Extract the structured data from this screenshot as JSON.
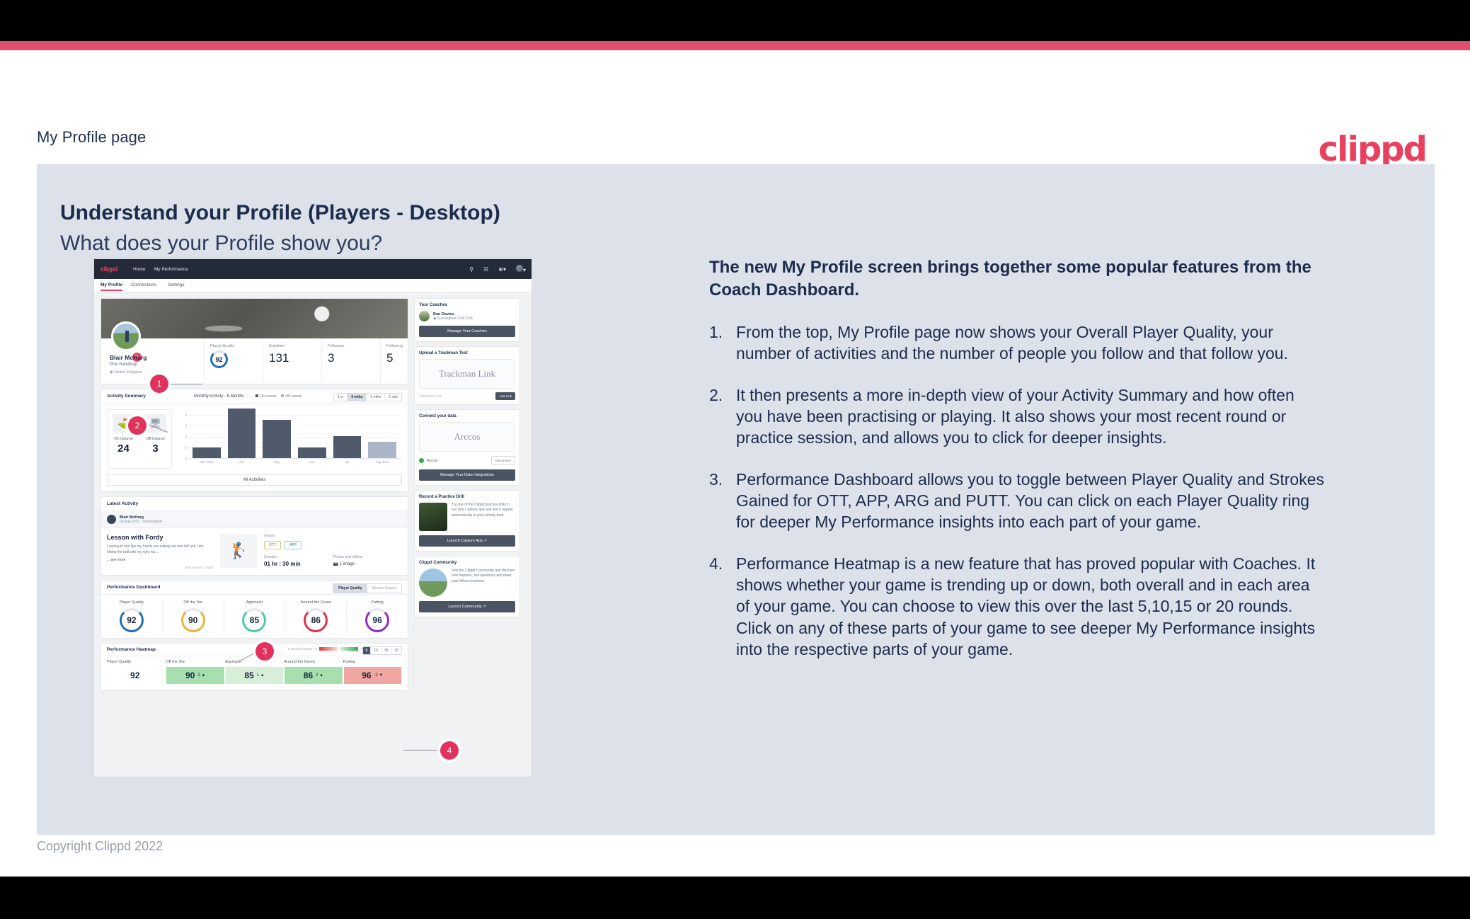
{
  "header": {
    "title": "My Profile page",
    "logo": "clippd"
  },
  "slide": {
    "heading": "Understand your Profile (Players - Desktop)",
    "subheading": "What does your Profile show you?",
    "copyright": "Copyright Clippd 2022"
  },
  "explanation": {
    "lead": "The new My Profile screen brings together some popular features from the Coach Dashboard.",
    "items": [
      {
        "num": "1.",
        "text": "From the top, My Profile page now shows your Overall Player Quality, your number of activities and the number of people you follow and that follow you."
      },
      {
        "num": "2.",
        "text": "It then presents a more in-depth view of your Activity Summary and how often you have been practising or playing. It also shows your most recent round or practice session, and allows you to click for deeper insights."
      },
      {
        "num": "3.",
        "text": "Performance Dashboard allows you to toggle between Player Quality and Strokes Gained for OTT, APP, ARG and PUTT. You can click on each Player Quality ring for deeper My Performance insights into each part of your game."
      },
      {
        "num": "4.",
        "text": "Performance Heatmap is a new feature that has proved popular with Coaches. It shows whether your game is trending up or down, both overall and in each area of your game. You can choose to view this over the last 5,10,15 or 20 rounds. Click on any of these parts of your game to see deeper My Performance insights into the respective parts of your game."
      }
    ]
  },
  "app": {
    "nav": {
      "logo": "clippd",
      "links": [
        "Home",
        "My Performance"
      ],
      "icons": [
        "search-icon",
        "community-icon",
        "add-icon",
        "avatar-icon"
      ]
    },
    "tabs": [
      {
        "label": "My Profile",
        "active": true
      },
      {
        "label": "Connections",
        "active": false
      },
      {
        "label": "Settings",
        "active": false
      }
    ],
    "profile": {
      "name": "Blair McHarg",
      "handicap": "Plus Handicap",
      "location": "United Kingdom",
      "stats": [
        {
          "label": "Player Quality",
          "value": "92",
          "type": "ring"
        },
        {
          "label": "Activities",
          "value": "131"
        },
        {
          "label": "Followers",
          "value": "3"
        },
        {
          "label": "Following",
          "value": "5"
        }
      ]
    },
    "activity": {
      "title": "Activity Summary",
      "chart_title": "Monthly Activity - 6 Months",
      "legend": [
        "On course",
        "Off course"
      ],
      "range_buttons": [
        {
          "label": "1 yr",
          "active": false
        },
        {
          "label": "6 mths",
          "active": true
        },
        {
          "label": "3 mths",
          "active": false
        },
        {
          "label": "1 mth",
          "active": false
        }
      ],
      "counters": [
        {
          "label": "On Course",
          "value": "24",
          "icon": "golf-flag-icon"
        },
        {
          "label": "Off Course",
          "value": "3",
          "icon": "monitor-icon"
        }
      ],
      "all_button": "All Activities"
    },
    "latest": {
      "title": "Latest Activity",
      "user": "Blair McHarg",
      "meta": "03 Aug 2022 - Sunningdale",
      "lesson_title": "Lesson with Fordy",
      "description": "Looking to feel like my hands are exiting low and left and I am hitting the ball with my right hip....",
      "see_more": "... see more",
      "source": "Data Source: Clippd",
      "type_label": "Lesson",
      "chips": [
        "OTT",
        "APP"
      ],
      "duration_label": "Duration",
      "duration": "01 hr : 30 min",
      "photos_label": "Photos and Videos",
      "photos": "1 image"
    },
    "dashboard": {
      "title": "Performance Dashboard",
      "toggle": [
        {
          "label": "Player Quality",
          "active": true
        },
        {
          "label": "Strokes Gained",
          "active": false
        }
      ],
      "rings": [
        {
          "label": "Player Quality",
          "value": "92",
          "color": "#1f6fb2"
        },
        {
          "label": "Off the Tee",
          "value": "90",
          "color": "#eab33a"
        },
        {
          "label": "Approach",
          "value": "85",
          "color": "#4fc9ad"
        },
        {
          "label": "Around the Green",
          "value": "86",
          "color": "#e0314f"
        },
        {
          "label": "Putting",
          "value": "96",
          "color": "#8e2fc4"
        }
      ]
    },
    "heatmap": {
      "title": "Performance Heatmap",
      "scale_label": "5 Round Change",
      "scale_min": "-5",
      "scale_max": "+5",
      "rounds_label": "Rounds",
      "rounds": [
        {
          "label": "5",
          "active": true
        },
        {
          "label": "10",
          "active": false
        },
        {
          "label": "15",
          "active": false
        },
        {
          "label": "20",
          "active": false
        }
      ],
      "cells": [
        {
          "label": "Player Quality",
          "value": "92",
          "delta": "",
          "bg": "#ffffff"
        },
        {
          "label": "Off the Tee",
          "value": "90",
          "delta": "2 ▲",
          "bg": "#a8dfae"
        },
        {
          "label": "Approach",
          "value": "85",
          "delta": "1 ▲",
          "bg": "#d7efd8"
        },
        {
          "label": "Around the Green",
          "value": "86",
          "delta": "2 ▲",
          "bg": "#a8dfae"
        },
        {
          "label": "Putting",
          "value": "96",
          "delta": "-2 ▼",
          "bg": "#f0a7a1"
        }
      ]
    },
    "side": {
      "coaches": {
        "title": "Your Coaches",
        "coach_name": "Dan Davies",
        "coach_club": "Sunningdale Golf Club",
        "button": "Manage Your Coaches"
      },
      "trackman": {
        "title": "Upload a Trackman Test",
        "panel_text": "Trackman Link",
        "input_placeholder": "Trackman Link",
        "button": "Add Link"
      },
      "connect": {
        "title": "Connect your data",
        "panel_text": "Arccos",
        "item": "Arccos",
        "item_button": "Disconnect",
        "button": "Manage Your Data Integrations"
      },
      "drill": {
        "title": "Record a Practice Drill",
        "text": "Try one of the Clippd practice drills in our new Capture app and see it appear automatically in your activity feed.",
        "button": "Launch Capture App ↗"
      },
      "community": {
        "title": "Clippd Community",
        "text": "Visit the Clippd Community and discover new features, ask questions and meet your fellow members.",
        "button": "Launch Community ↗"
      }
    },
    "markers": [
      "1",
      "2",
      "3",
      "4"
    ]
  },
  "chart_data": {
    "type": "bar",
    "title": "Monthly Activity - 6 Months",
    "categories": [
      "Mar 2022",
      "Apr",
      "May",
      "Jun",
      "Jul",
      "Aug 2022"
    ],
    "values": [
      2,
      9,
      7,
      2,
      4,
      3
    ],
    "series_of_bar": [
      "On course",
      "On course",
      "On course",
      "On course",
      "On course",
      "Off course"
    ],
    "legend": [
      "On course",
      "Off course"
    ],
    "xlabel": "",
    "ylabel": "",
    "ylim": [
      0,
      9
    ],
    "yticks": [
      0,
      2,
      4,
      6,
      8
    ],
    "grid": true,
    "legend_position": "top"
  }
}
